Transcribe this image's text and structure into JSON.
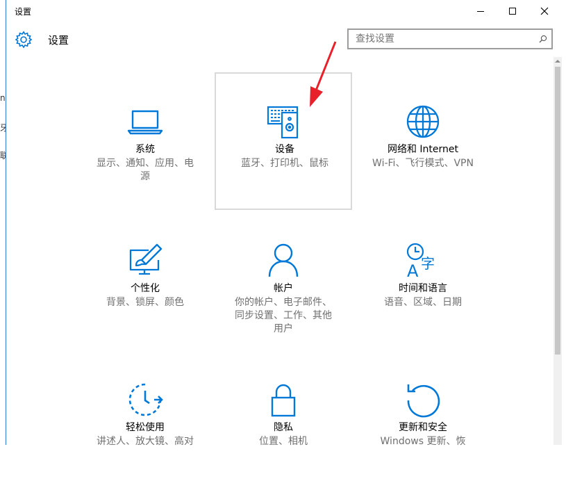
{
  "window": {
    "title": "设置",
    "controls": {
      "minimize": "minimize",
      "maximize": "maximize",
      "close": "close"
    }
  },
  "header": {
    "title": "设置",
    "icon": "gear-icon"
  },
  "search": {
    "placeholder": "查找设置",
    "icon": "search-icon"
  },
  "accent": "#0078d7",
  "tiles": [
    {
      "title": "系统",
      "desc": "显示、通知、应用、电源",
      "icon": "laptop-icon"
    },
    {
      "title": "设备",
      "desc": "蓝牙、打印机、鼠标",
      "icon": "devices-icon"
    },
    {
      "title": "网络和 Internet",
      "desc": "Wi-Fi、飞行模式、VPN",
      "icon": "globe-icon"
    },
    {
      "title": "个性化",
      "desc": "背景、锁屏、颜色",
      "icon": "personalization-icon"
    },
    {
      "title": "帐户",
      "desc": "你的帐户、电子邮件、同步设置、工作、其他用户",
      "icon": "person-icon"
    },
    {
      "title": "时间和语言",
      "desc": "语音、区域、日期",
      "icon": "time-language-icon"
    },
    {
      "title": "轻松使用",
      "desc": "讲述人、放大镜、高对",
      "icon": "ease-of-access-icon"
    },
    {
      "title": "隐私",
      "desc": "位置、相机",
      "icon": "lock-icon"
    },
    {
      "title": "更新和安全",
      "desc": "Windows 更新、恢",
      "icon": "refresh-icon"
    }
  ],
  "background_text": [
    "n",
    "牙",
    "联"
  ]
}
